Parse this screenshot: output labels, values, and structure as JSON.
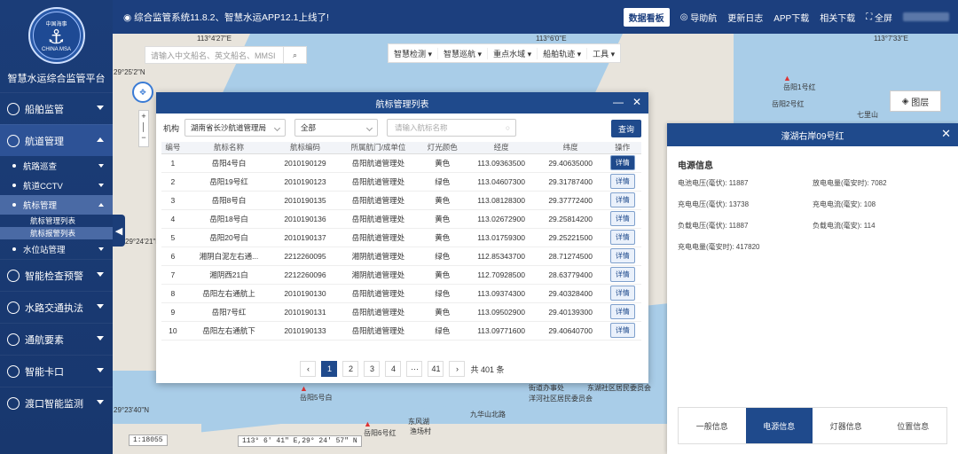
{
  "header": {
    "notice": "综合监管系统11.8.2、智慧水运APP12.1上线了!",
    "dashboard": "数据看板",
    "guide": "导助航",
    "changelog": "更新日志",
    "app_download": "APP下载",
    "related_download": "相关下载",
    "fullscreen": "全屏"
  },
  "sidebar": {
    "platform_title": "智慧水运综合监管平台",
    "logo_text_top": "中国海事",
    "logo_text_bottom": "CHINA MSA",
    "items": [
      {
        "label": "船舶监管"
      },
      {
        "label": "航道管理"
      },
      {
        "label": "智能检查预警"
      },
      {
        "label": "水路交通执法"
      },
      {
        "label": "通航要素"
      },
      {
        "label": "智能卡口"
      },
      {
        "label": "渡口智能监测"
      }
    ],
    "subitems": [
      {
        "label": "航路巡查"
      },
      {
        "label": "航道CCTV"
      },
      {
        "label": "航标管理"
      },
      {
        "label": "水位站管理"
      }
    ],
    "subsub": [
      {
        "label": "航标管理列表"
      },
      {
        "label": "航标报警列表"
      }
    ]
  },
  "map": {
    "search_placeholder": "请输入中文船名、英文船名、MMSI",
    "tools": [
      "智慧检测 ▾",
      "智慧巡航 ▾",
      "重点水域 ▾",
      "船舶轨迹 ▾",
      "工具 ▾"
    ],
    "layers": "图层",
    "scale": "1:18055",
    "cursor_coord": "113° 6' 41\" E,29° 24' 57\" N",
    "coords": [
      "113°4'27\"E",
      "113°6'0\"E",
      "113°7'33\"E",
      "29°25'2\"N",
      "29°24'21\"N",
      "29°23'40\"N"
    ],
    "buoys": [
      "岳阳1号红",
      "岳阳2号红",
      "岳阳5号白",
      "岳阳6号红"
    ],
    "places": [
      "七里山",
      "东风湖",
      "渔场村",
      "九华山北路",
      "街道办事处",
      "东湖社区居民委员会",
      "洋河社区居民委员会"
    ]
  },
  "dialog": {
    "title": "航标管理列表",
    "org_label": "机构",
    "org_value": "湖南省长沙航道管理局",
    "status_value": "全部",
    "name_placeholder": "请输入航标名称",
    "query": "查询",
    "columns": [
      "编号",
      "航标名称",
      "航标编码",
      "所属航门/成单位",
      "灯光颜色",
      "经度",
      "纬度",
      "操作"
    ],
    "rows": [
      [
        "1",
        "岳阳4号白",
        "2010190129",
        "岳阳航道管理处",
        "黄色",
        "113.09363500",
        "29.40635000",
        "详情"
      ],
      [
        "2",
        "岳阳19号红",
        "2010190123",
        "岳阳航道管理处",
        "绿色",
        "113.04607300",
        "29.31787400",
        "详情"
      ],
      [
        "3",
        "岳阳8号白",
        "2010190135",
        "岳阳航道管理处",
        "黄色",
        "113.08128300",
        "29.37772400",
        "详情"
      ],
      [
        "4",
        "岳阳18号白",
        "2010190136",
        "岳阳航道管理处",
        "黄色",
        "113.02672900",
        "29.25814200",
        "详情"
      ],
      [
        "5",
        "岳阳20号白",
        "2010190137",
        "岳阳航道管理处",
        "黄色",
        "113.01759300",
        "29.25221500",
        "详情"
      ],
      [
        "6",
        "湘阴白泥左右通...",
        "2212260095",
        "湘阴航道管理处",
        "绿色",
        "112.85343700",
        "28.71274500",
        "详情"
      ],
      [
        "7",
        "湘阴西21白",
        "2212260096",
        "湘阴航道管理处",
        "黄色",
        "112.70928500",
        "28.63779400",
        "详情"
      ],
      [
        "8",
        "岳阳左右通航上",
        "2010190130",
        "岳阳航道管理处",
        "绿色",
        "113.09374300",
        "29.40328400",
        "详情"
      ],
      [
        "9",
        "岳阳7号红",
        "2010190131",
        "岳阳航道管理处",
        "黄色",
        "113.09502900",
        "29.40139300",
        "详情"
      ],
      [
        "10",
        "岳阳左右通航下",
        "2010190133",
        "岳阳航道管理处",
        "绿色",
        "113.09771600",
        "29.40640700",
        "详情"
      ]
    ],
    "pager": {
      "prev": "‹",
      "pages": [
        "1",
        "2",
        "3",
        "4",
        "···",
        "41"
      ],
      "next": "›",
      "total": "共 401 条"
    }
  },
  "detail": {
    "title": "濠湖右岸09号红",
    "section": "电源信息",
    "fields": [
      "电池电压(毫伏): 11887",
      "放电电量(毫安时): 7082",
      "充电电压(毫伏): 13738",
      "充电电流(毫安): 108",
      "负载电压(毫伏): 11887",
      "负载电流(毫安): 114",
      "充电电量(毫安时): 417820"
    ],
    "tabs": [
      "一般信息",
      "电源信息",
      "灯器信息",
      "位置信息"
    ],
    "active_tab": "电源信息"
  }
}
